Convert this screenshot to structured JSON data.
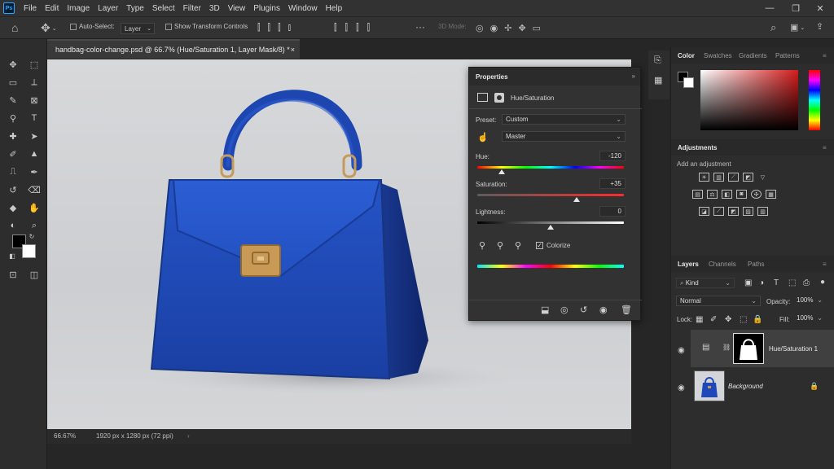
{
  "menu": [
    "File",
    "Edit",
    "Image",
    "Layer",
    "Type",
    "Select",
    "Filter",
    "3D",
    "View",
    "Plugins",
    "Window",
    "Help"
  ],
  "app_icon_text": "Ps",
  "window_controls": {
    "minimize": "—",
    "restore": "❐",
    "close": "✕"
  },
  "options": {
    "auto_select_label": "Auto-Select:",
    "auto_select_value": "Layer",
    "show_transform_label": "Show Transform Controls",
    "mode_3d_label": "3D Mode:",
    "more": "···"
  },
  "document": {
    "tab_title": "handbag-color-change.psd @ 66.7% (Hue/Saturation 1, Layer Mask/8) *",
    "close_glyph": "×",
    "zoom": "66.67%",
    "info": "1920 px x 1280 px (72 ppi)"
  },
  "properties": {
    "title": "Properties",
    "adjustment_name": "Hue/Saturation",
    "preset_label": "Preset:",
    "preset_value": "Custom",
    "channel_value": "Master",
    "hue_label": "Hue:",
    "hue_value": "-120",
    "saturation_label": "Saturation:",
    "saturation_value": "+35",
    "lightness_label": "Lightness:",
    "lightness_value": "0",
    "colorize_label": "Colorize",
    "colorize_checked": true,
    "hue_slider_fraction": 0.167,
    "saturation_slider_fraction": 0.675,
    "lightness_slider_fraction": 0.5
  },
  "color_panel": {
    "tabs": [
      "Color",
      "Swatches",
      "Gradients",
      "Patterns"
    ],
    "accent": "#d41c1c"
  },
  "adjustments_panel": {
    "title": "Adjustments",
    "subtitle": "Add an adjustment"
  },
  "layers_panel": {
    "tabs": [
      "Layers",
      "Channels",
      "Paths"
    ],
    "filter_kind": "Kind",
    "blend_mode": "Normal",
    "opacity_label": "Opacity:",
    "opacity_value": "100%",
    "lock_label": "Lock:",
    "fill_label": "Fill:",
    "fill_value": "100%",
    "layers": [
      {
        "name": "Hue/Saturation 1",
        "selected": true
      },
      {
        "name": "Background",
        "locked": true
      }
    ]
  },
  "colors": {
    "bag_blue": "#1f49b8",
    "ui_bg": "#323232",
    "panel_bg": "#2d2d2d"
  }
}
